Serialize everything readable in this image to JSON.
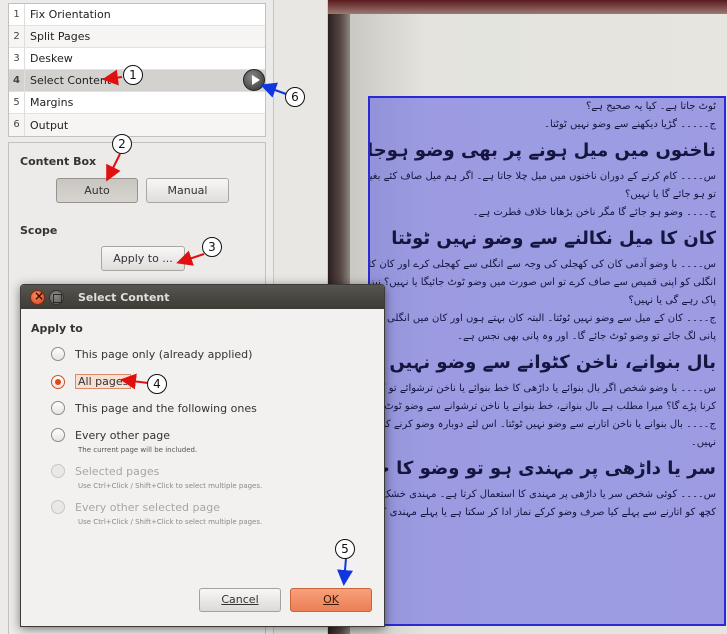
{
  "stages": [
    {
      "num": "1",
      "label": "Fix Orientation"
    },
    {
      "num": "2",
      "label": "Split Pages"
    },
    {
      "num": "3",
      "label": "Deskew"
    },
    {
      "num": "4",
      "label": "Select Content"
    },
    {
      "num": "5",
      "label": "Margins"
    },
    {
      "num": "6",
      "label": "Output"
    }
  ],
  "options": {
    "content_box_title": "Content Box",
    "auto_label": "Auto",
    "manual_label": "Manual",
    "scope_title": "Scope",
    "apply_to_label": "Apply to ..."
  },
  "dialog": {
    "title": "Select Content",
    "apply_to_title": "Apply to",
    "options": [
      {
        "label": "This page only (already applied)",
        "state": "normal"
      },
      {
        "label": "All pages",
        "state": "checked"
      },
      {
        "label": "This page and the following ones",
        "state": "normal"
      },
      {
        "label": "Every other page",
        "state": "normal",
        "hint": "The current page will be included."
      },
      {
        "label": "Selected pages",
        "state": "disabled",
        "hint": "Use Ctrl+Click / Shift+Click to select multiple pages."
      },
      {
        "label": "Every other selected page",
        "state": "disabled",
        "hint": "Use Ctrl+Click / Shift+Click to select multiple pages."
      }
    ],
    "cancel_label": "Cancel",
    "ok_label": "OK"
  },
  "callouts": [
    "1",
    "2",
    "3",
    "4",
    "5",
    "6"
  ],
  "page_text": [
    {
      "style": "body",
      "text": "ٹوٹ جاتا ہے۔ کیا یہ صحیح ہے؟"
    },
    {
      "style": "body",
      "text": "ج۔۔۔۔۔ گڑیا دیکھنے سے وضو نہیں ٹوٹتا۔"
    },
    {
      "style": "head",
      "text": "ناخنوں میں میل ہونے پر بھی وضو ہوجاتا ہے"
    },
    {
      "style": "body",
      "text": "س۔۔۔۔ کام کرنے کے دوران ناخنوں میں میل چلا جاتا ہے۔ اگر ہم میل صاف کئے بغیر وضو کریں"
    },
    {
      "style": "body",
      "text": "تو ہو جائے گا یا نہیں؟"
    },
    {
      "style": "body",
      "text": "ج۔۔۔۔ وضو ہو جائے گا مگر ناخن بڑھانا خلاف فطرت ہے۔"
    },
    {
      "style": "head",
      "text": "کان کا میل نکالنے سے وضو نہیں ٹوٹتا"
    },
    {
      "style": "body",
      "text": "س۔۔۔۔ با وضو آدمی کان کی کھجلی کی وجہ سے انگلی سے کھجلی کرے اور کان کا موم انگلی کو"
    },
    {
      "style": "body",
      "text": "انگلی کو اپنی قمیص سے صاف کرے تو اس صورت میں وضو ٹوٹ جائیگا یا نہیں؟ نیز قمیص پر موم لگنے"
    },
    {
      "style": "body",
      "text": "پاک رہے گی یا نہیں؟"
    },
    {
      "style": "body",
      "text": "ج۔۔۔۔ کان کے میل سے وضو نہیں ٹوٹتا۔ البتہ کان بہتے ہوں اور کان میں انگلی ڈالنے سے"
    },
    {
      "style": "body",
      "text": "پانی لگ جائے تو وضو ٹوٹ جائے گا۔ اور وہ پانی بھی نجس ہے۔"
    },
    {
      "style": "head",
      "text": "بال بنوانے، ناخن کٹوانے سے وضو نہیں ٹوٹتا"
    },
    {
      "style": "body",
      "text": "س۔۔۔۔ با وضو شخص اگر بال بنوائے یا داڑھی کا خط بنوائے یا ناخن ترشوائے تو کیا اسے دوبارہ"
    },
    {
      "style": "body",
      "text": "کرنا پڑے گا؟ میرا مطلب ہے بال بنوانے، خط بنوانے یا ناخن ترشوانے سے وضو ٹوٹ جاتا ہے؟"
    },
    {
      "style": "body",
      "text": "ج۔۔۔۔ بال بنوانے یا ناخن اتارنے سے وضو نہیں ٹوٹتا۔ اس لئے دوبارہ وضو کرنے کی ضرورت"
    },
    {
      "style": "body",
      "text": "نہیں۔"
    },
    {
      "style": "head",
      "text": "سر یا داڑھی پر مہندی ہو تو وضو کا حکم"
    },
    {
      "style": "body",
      "text": "س۔۔۔۔ کوئی شخص سر یا داڑھی پر مہندی کا استعمال کرتا ہے۔ مہندی خشک ہوجانے کے بعد"
    },
    {
      "style": "body",
      "text": "کچھ کو اتارنے سے پہلے کیا صرف وضو کرکے نماز ادا کر سکتا ہے یا پہلے مہندی کو بھی دھو کر وضو کرے"
    }
  ]
}
